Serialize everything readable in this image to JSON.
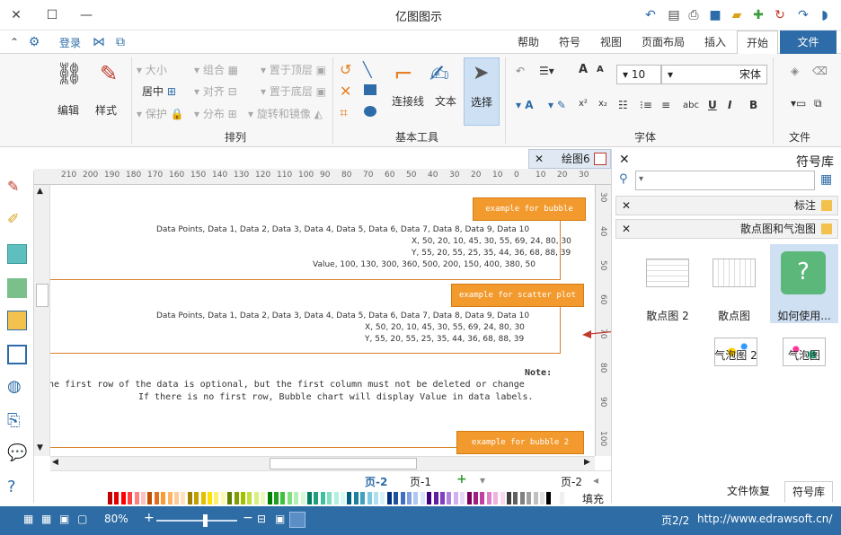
{
  "app": {
    "title": "亿图图示",
    "login_label": "登录"
  },
  "tabs": [
    {
      "label": "文件"
    },
    {
      "label": "开始"
    },
    {
      "label": "插入"
    },
    {
      "label": "页面布局"
    },
    {
      "label": "视图"
    },
    {
      "label": "符号"
    },
    {
      "label": "帮助"
    }
  ],
  "ribbon": {
    "file_group": {
      "label": "文件"
    },
    "font_group": {
      "label": "字体",
      "font_name": "宋体",
      "font_size": "10"
    },
    "tools_group": {
      "label": "基本工具",
      "select": "选择",
      "text": "文本",
      "connector": "连接线"
    },
    "arrange_group": {
      "label": "排列",
      "bring_front": "置于顶层",
      "send_back": "置于底层",
      "rotate_flip": "旋转和镜像",
      "group": "组合",
      "align": "对齐",
      "distribute": "分布",
      "size": "大小",
      "center": "居中",
      "protect": "保护"
    },
    "style_label": "样式",
    "edit_label": "编辑"
  },
  "document": {
    "tab_label": "绘图6",
    "ruler_h": [
      "30",
      "20",
      "10",
      "0",
      "10",
      "20",
      "30",
      "40",
      "50",
      "60",
      "70",
      "80",
      "90",
      "100",
      "110",
      "120",
      "130",
      "140",
      "150",
      "160",
      "170",
      "180",
      "190",
      "200",
      "210"
    ],
    "ruler_v": [
      "30",
      "40",
      "50",
      "60",
      "70",
      "80",
      "90",
      "100"
    ],
    "blocks": {
      "bubble": {
        "tag": "example for bubble",
        "lines": [
          "Data Points, Data 1, Data 2, Data 3, Data 4, Data 5, Data 6, Data 7, Data 8, Data 9, Data 10",
          "X, 50, 20, 10, 45, 30, 55, 69, 24, 80, 30",
          "Y, 55, 20, 55, 25, 35, 44, 36, 68, 88, 39",
          "Value, 100, 130, 300, 360, 500, 200, 150, 400, 380, 50"
        ]
      },
      "scatter": {
        "tag": "example for scatter plot",
        "lines": [
          "Data Points, Data 1, Data 2, Data 3, Data 4, Data 5, Data 6, Data 7, Data 8, Data 9, Data 10",
          "X, 50, 20, 10, 45, 30, 55, 69, 24, 80, 30",
          "Y, 55, 20, 55, 25, 35, 44, 36, 68, 88, 39"
        ]
      },
      "note": {
        "title": "Note:",
        "lines": [
          "The first row of the data is optional, but the first column must not be deleted or change",
          "If there is no first row, Bubble chart will display Value in data labels."
        ]
      },
      "bubble2": {
        "tag": "example for bubble 2"
      }
    },
    "pages": [
      {
        "label": "页-2"
      },
      {
        "label": "页-1"
      },
      {
        "label": "页-2"
      }
    ],
    "fill_label": "填充"
  },
  "library": {
    "title": "符号库",
    "search_placeholder": "",
    "sections": [
      {
        "label": "标注"
      },
      {
        "label": "散点图和气泡图"
      }
    ],
    "symbols": [
      {
        "label": "如何使用..."
      },
      {
        "label": "散点图"
      },
      {
        "label": "散点图 2"
      },
      {
        "label": "气泡图"
      },
      {
        "label": "气泡图 2"
      }
    ],
    "bottom_tabs": [
      {
        "label": "符号库"
      },
      {
        "label": "文件恢复"
      }
    ]
  },
  "status": {
    "url": "http://www.edrawsoft.cn/",
    "page_info": "页2/2",
    "zoom": "80%",
    "zoom_level": 0.6
  },
  "palette": [
    "#c00000",
    "#e00000",
    "#ff0000",
    "#ff4040",
    "#ff8080",
    "#ffc0c0",
    "#c05000",
    "#e07020",
    "#ff9933",
    "#ffb366",
    "#ffcc99",
    "#ffe0c0",
    "#a08000",
    "#c0a000",
    "#e0c000",
    "#ffe000",
    "#fff066",
    "#fff8b0",
    "#608000",
    "#80a000",
    "#a0c000",
    "#c0e040",
    "#d8f080",
    "#ecf8c0",
    "#008000",
    "#20a020",
    "#40c040",
    "#80e080",
    "#b0f0b0",
    "#d8f8d8",
    "#008060",
    "#20a080",
    "#40c0a0",
    "#80e0c0",
    "#b0f0e0",
    "#d8f8f0",
    "#006080",
    "#2080a0",
    "#40a0c0",
    "#80c8e0",
    "#b0e0f0",
    "#d8f0f8",
    "#003080",
    "#2050a0",
    "#4070c0",
    "#80a0e0",
    "#b0c8f0",
    "#d8e4f8",
    "#400080",
    "#6020a0",
    "#8040c0",
    "#b080e0",
    "#d0b0f0",
    "#e8d8f8",
    "#800060",
    "#a02080",
    "#c040a0",
    "#e080c8",
    "#f0b0e0",
    "#f8d8f0",
    "#404040",
    "#606060",
    "#808080",
    "#a0a0a0",
    "#c0c0c0",
    "#e0e0e0",
    "#000000",
    "#ffffff",
    "#f0f0f0"
  ]
}
